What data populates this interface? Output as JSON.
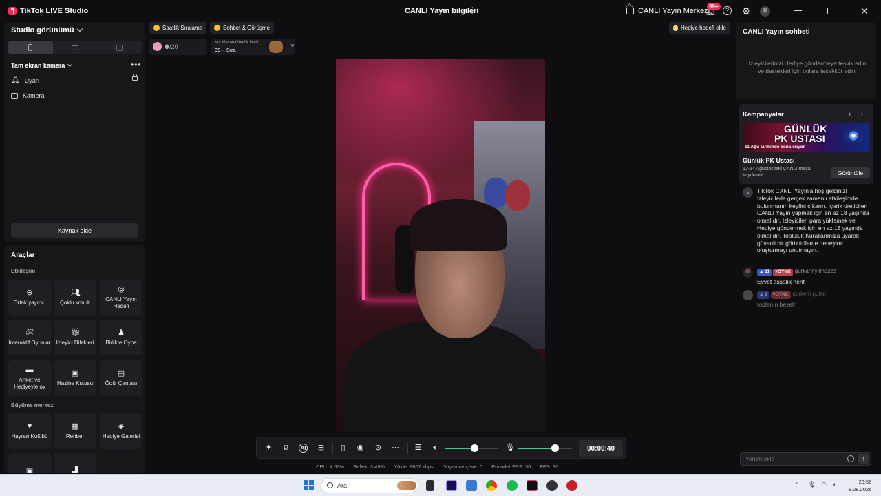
{
  "window": {
    "app_title": "TikTok LIVE Studio",
    "center_title": "CANLI Yayın bilgileri",
    "hub_label": "CANLI Yayın Merkezi",
    "notif_badge": "99+"
  },
  "left": {
    "studio_view": "Studio görünümü",
    "camera_title": "Tam ekran kamera",
    "sources": [
      "Uyarı",
      "Kamera"
    ],
    "add_source": "Kaynak ekle",
    "tools_title": "Araçlar",
    "section_interaction": "Etkileşim",
    "section_growth": "Büyüme merkezi",
    "tiles_interaction": [
      {
        "label": "Ortak yayıncı",
        "icon": "link-icon"
      },
      {
        "label": "Çoklu konuk",
        "icon": "users-icon"
      },
      {
        "label": "CANLI Yayın Hedefi",
        "icon": "target-icon"
      },
      {
        "label": "İnteraktif Oyunlar",
        "icon": "gamepad-icon"
      },
      {
        "label": "İzleyici Dilekleri",
        "icon": "gift-icon"
      },
      {
        "label": "Birlikte Oyna",
        "icon": "joystick-icon"
      },
      {
        "label": "Anket ve Hediyeyle oy",
        "icon": "poll-icon"
      },
      {
        "label": "Hazine Kutusu",
        "icon": "treasure-icon"
      },
      {
        "label": "Ödül Çantası",
        "icon": "bag-icon"
      }
    ],
    "tiles_growth": [
      {
        "label": "Hayran Kulübü",
        "icon": "heart-icon"
      },
      {
        "label": "Rehber",
        "icon": "book-icon"
      },
      {
        "label": "Hediye Galerisi",
        "icon": "gallery-icon"
      }
    ]
  },
  "stage": {
    "chip_hourly": "Saatlik Sıralama",
    "chip_chat": "Sohbet & Görüşme",
    "goal_current": "0",
    "goal_total": "/20",
    "rank_title": "Kış Masalı-Günlük Hedi...",
    "rank_value": "99+. Sıra",
    "gift_goal_btn": "Hediye hedefi ekle",
    "volume_level": 0.55,
    "mic_level": 0.68,
    "timer": "00:00:40"
  },
  "stats": [
    {
      "label": "CPU:",
      "value": "4.63%"
    },
    {
      "label": "Bellek:",
      "value": "3.49%"
    },
    {
      "label": "Yükle:",
      "value": "8807 kbps"
    },
    {
      "label": "Düşen çerçeve:",
      "value": "0"
    },
    {
      "label": "Encoder FPS:",
      "value": "30"
    },
    {
      "label": "FPS:",
      "value": "30"
    }
  ],
  "right": {
    "chat_title": "CANLI Yayın sohbeti",
    "chat_hint": "İzleyicilerinizi Hediye göndermeye teşvik edin ve destekleri için onlara teşekkür edin.",
    "campaigns_title": "Kampanyalar",
    "banner_line1": "GÜNLÜK",
    "banner_line2": "PK USTASI",
    "banner_sub": "11 Ağu tarihinde sona eriyor",
    "campaign_name": "Günlük PK Ustası",
    "campaign_sub": "12-14 Ağustos'taki CANLI maça kaydolun!",
    "view_btn": "Görüntüle",
    "welcome": "TikTok CANLI Yayın'a hoş geldiniz! İzleyicilerle gerçek zamanlı etkileşimde bulunmanın keyfini çıkarın. İçerik üreticileri CANLI Yayın yapmak için en az 18 yaşında olmalıdır. İzleyiciler, para yüklemek ve Hediye göndermek için en az 18 yaşında olmalıdır. Topluluk Kurallarımıza uyarak güvenli bir görüntüleme deneyimi oluşturmayı unutmayın.",
    "messages": [
      {
        "level": "11",
        "tag": "OYNK",
        "user": "gurkannyilmazzz",
        "text": "Evvet aşşalık herif"
      },
      {
        "level": "9",
        "tag": "OYNK",
        "user": "gorkem gulen",
        "text": "toplanın beyelr"
      }
    ],
    "comment_placeholder": "Yorum ekle"
  },
  "taskbar": {
    "search_label": "Ara",
    "time": "23:56",
    "date": "8.08.2026"
  },
  "colors": {
    "accent": "#fe2c55",
    "slider": "#2ad58e",
    "panel": "#17171a"
  }
}
